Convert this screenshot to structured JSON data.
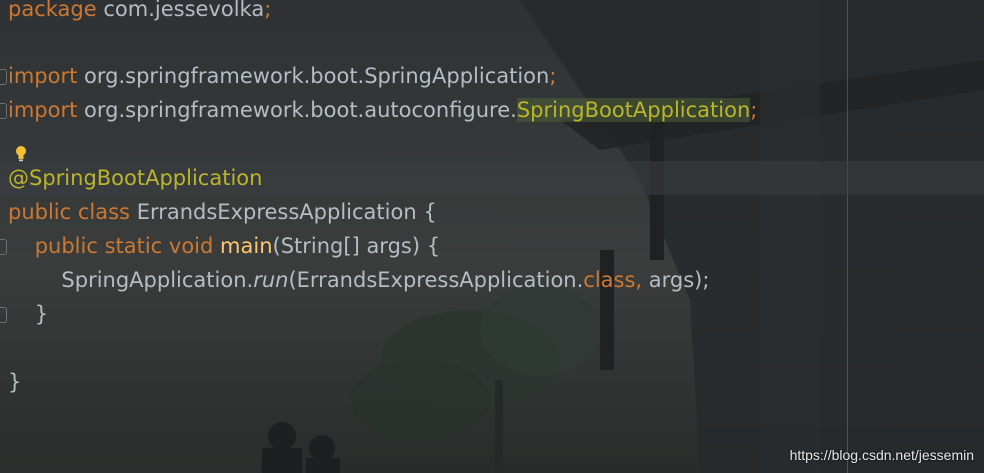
{
  "code": {
    "package_kw": "package",
    "package_name": "com.jessevolka",
    "semicolon": ";",
    "import_kw": "import",
    "import1_path": "org.springframework.boot.SpringApplication",
    "import2_prefix": "org.springframework.boot.autoconfigure.",
    "import2_class": "SpringBootApplication",
    "annotation": "@SpringBootApplication",
    "class_modifiers": "public class",
    "class_name": "ErrandsExpressApplication",
    "open_brace": " {",
    "method_modifiers": "public static void",
    "method_name": "main",
    "method_params": "(String[] args) {",
    "call_target": "SpringApplication.",
    "call_method": "run",
    "call_arg1": "(ErrandsExpressApplication.",
    "class_kw": "class,",
    "call_arg2": " args);",
    "close_brace": "}"
  },
  "watermark": "https://blog.csdn.net/jessemin",
  "colors": {
    "keyword": "#cc7832",
    "annotation": "#bbb529",
    "method_decl": "#ffc66d",
    "text": "#b6bcc4",
    "background": "#2b2e30"
  },
  "icons": {
    "intention": "lightbulb-icon",
    "fold": "fold-marker-icon"
  }
}
